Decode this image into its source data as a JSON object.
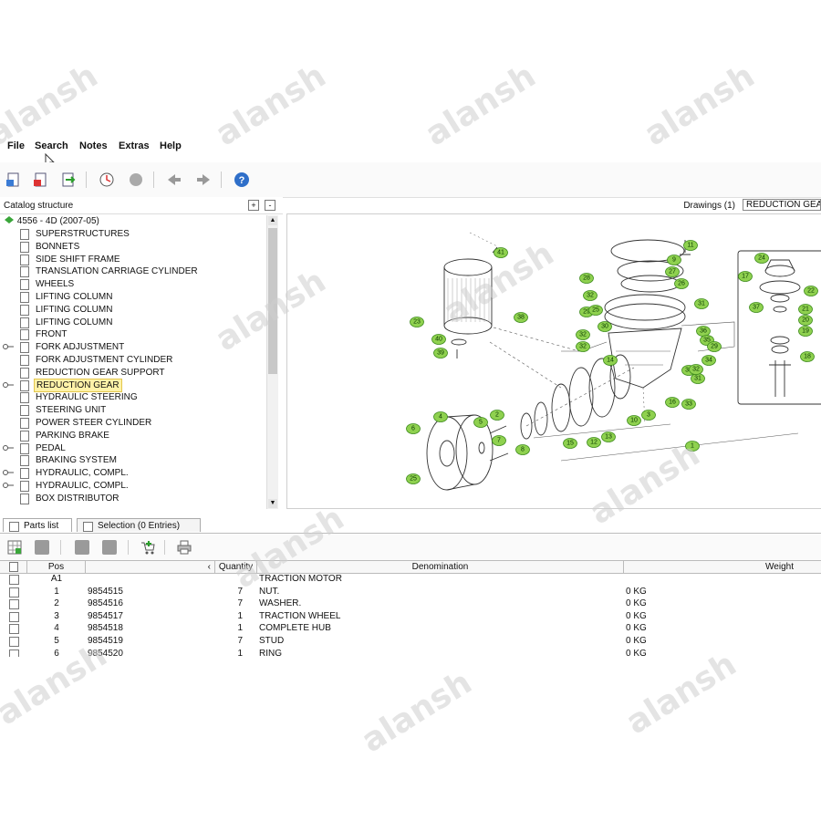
{
  "menu": [
    "File",
    "Search",
    "Notes",
    "Extras",
    "Help"
  ],
  "catalog": {
    "title": "Catalog structure",
    "expand_btn": "+",
    "collapse_btn": "-",
    "root": "4556 - 4D (2007-05)",
    "items": [
      {
        "label": "SUPERSTRUCTURES",
        "expandable": false
      },
      {
        "label": "BONNETS",
        "expandable": false
      },
      {
        "label": "SIDE SHIFT FRAME",
        "expandable": false
      },
      {
        "label": "TRANSLATION CARRIAGE CYLINDER",
        "expandable": false
      },
      {
        "label": "WHEELS",
        "expandable": false
      },
      {
        "label": "LIFTING COLUMN",
        "expandable": false
      },
      {
        "label": "LIFTING COLUMN",
        "expandable": false
      },
      {
        "label": "LIFTING COLUMN",
        "expandable": false
      },
      {
        "label": "FRONT",
        "expandable": false
      },
      {
        "label": "FORK ADJUSTMENT",
        "expandable": true
      },
      {
        "label": "FORK ADJUSTMENT CYLINDER",
        "expandable": false
      },
      {
        "label": "REDUCTION GEAR SUPPORT",
        "expandable": false
      },
      {
        "label": "REDUCTION GEAR",
        "expandable": true,
        "selected": true
      },
      {
        "label": "HYDRAULIC STEERING",
        "expandable": false
      },
      {
        "label": "STEERING UNIT",
        "expandable": false
      },
      {
        "label": "POWER STEER CYLINDER",
        "expandable": false
      },
      {
        "label": "PARKING BRAKE",
        "expandable": false
      },
      {
        "label": "PEDAL",
        "expandable": true
      },
      {
        "label": "BRAKING SYSTEM",
        "expandable": false
      },
      {
        "label": "HYDRAULIC, COMPL.",
        "expandable": true
      },
      {
        "label": "HYDRAULIC, COMPL.",
        "expandable": true
      },
      {
        "label": "BOX DISTRIBUTOR",
        "expandable": false
      }
    ]
  },
  "drawings": {
    "label": "Drawings (1)",
    "tab": "REDUCTION GEAR",
    "callouts": [
      "41",
      "11",
      "24",
      "9",
      "27",
      "28",
      "26",
      "17",
      "22",
      "31",
      "32",
      "29",
      "25",
      "37",
      "21",
      "20",
      "19",
      "38",
      "23",
      "40",
      "39",
      "30",
      "32",
      "32",
      "36",
      "35",
      "29",
      "34",
      "18",
      "14",
      "33",
      "31",
      "32",
      "33",
      "16",
      "10",
      "3",
      "4",
      "5",
      "2",
      "6",
      "7",
      "8",
      "15",
      "12",
      "13",
      "1",
      "25"
    ]
  },
  "tabs": {
    "parts": "Parts list",
    "selection": "Selection (0 Entries)"
  },
  "grid": {
    "headers": {
      "pos": "Pos",
      "quantity": "Quantity",
      "denomination": "Denomination",
      "weight": "Weight"
    },
    "rows": [
      {
        "pos": "A1",
        "number": "",
        "qty": "",
        "name": "TRACTION MOTOR",
        "weight": ""
      },
      {
        "pos": "1",
        "number": "9854515",
        "qty": "7",
        "name": "NUT.",
        "weight": "0 KG"
      },
      {
        "pos": "2",
        "number": "9854516",
        "qty": "7",
        "name": "WASHER.",
        "weight": "0 KG"
      },
      {
        "pos": "3",
        "number": "9854517",
        "qty": "1",
        "name": "TRACTION WHEEL",
        "weight": "0 KG"
      },
      {
        "pos": "4",
        "number": "9854518",
        "qty": "1",
        "name": "COMPLETE HUB",
        "weight": "0 KG"
      },
      {
        "pos": "5",
        "number": "9854519",
        "qty": "7",
        "name": "STUD",
        "weight": "0 KG"
      },
      {
        "pos": "6",
        "number": "9854520",
        "qty": "1",
        "name": "RING",
        "weight": "0 KG"
      }
    ]
  },
  "watermark": "alansh"
}
